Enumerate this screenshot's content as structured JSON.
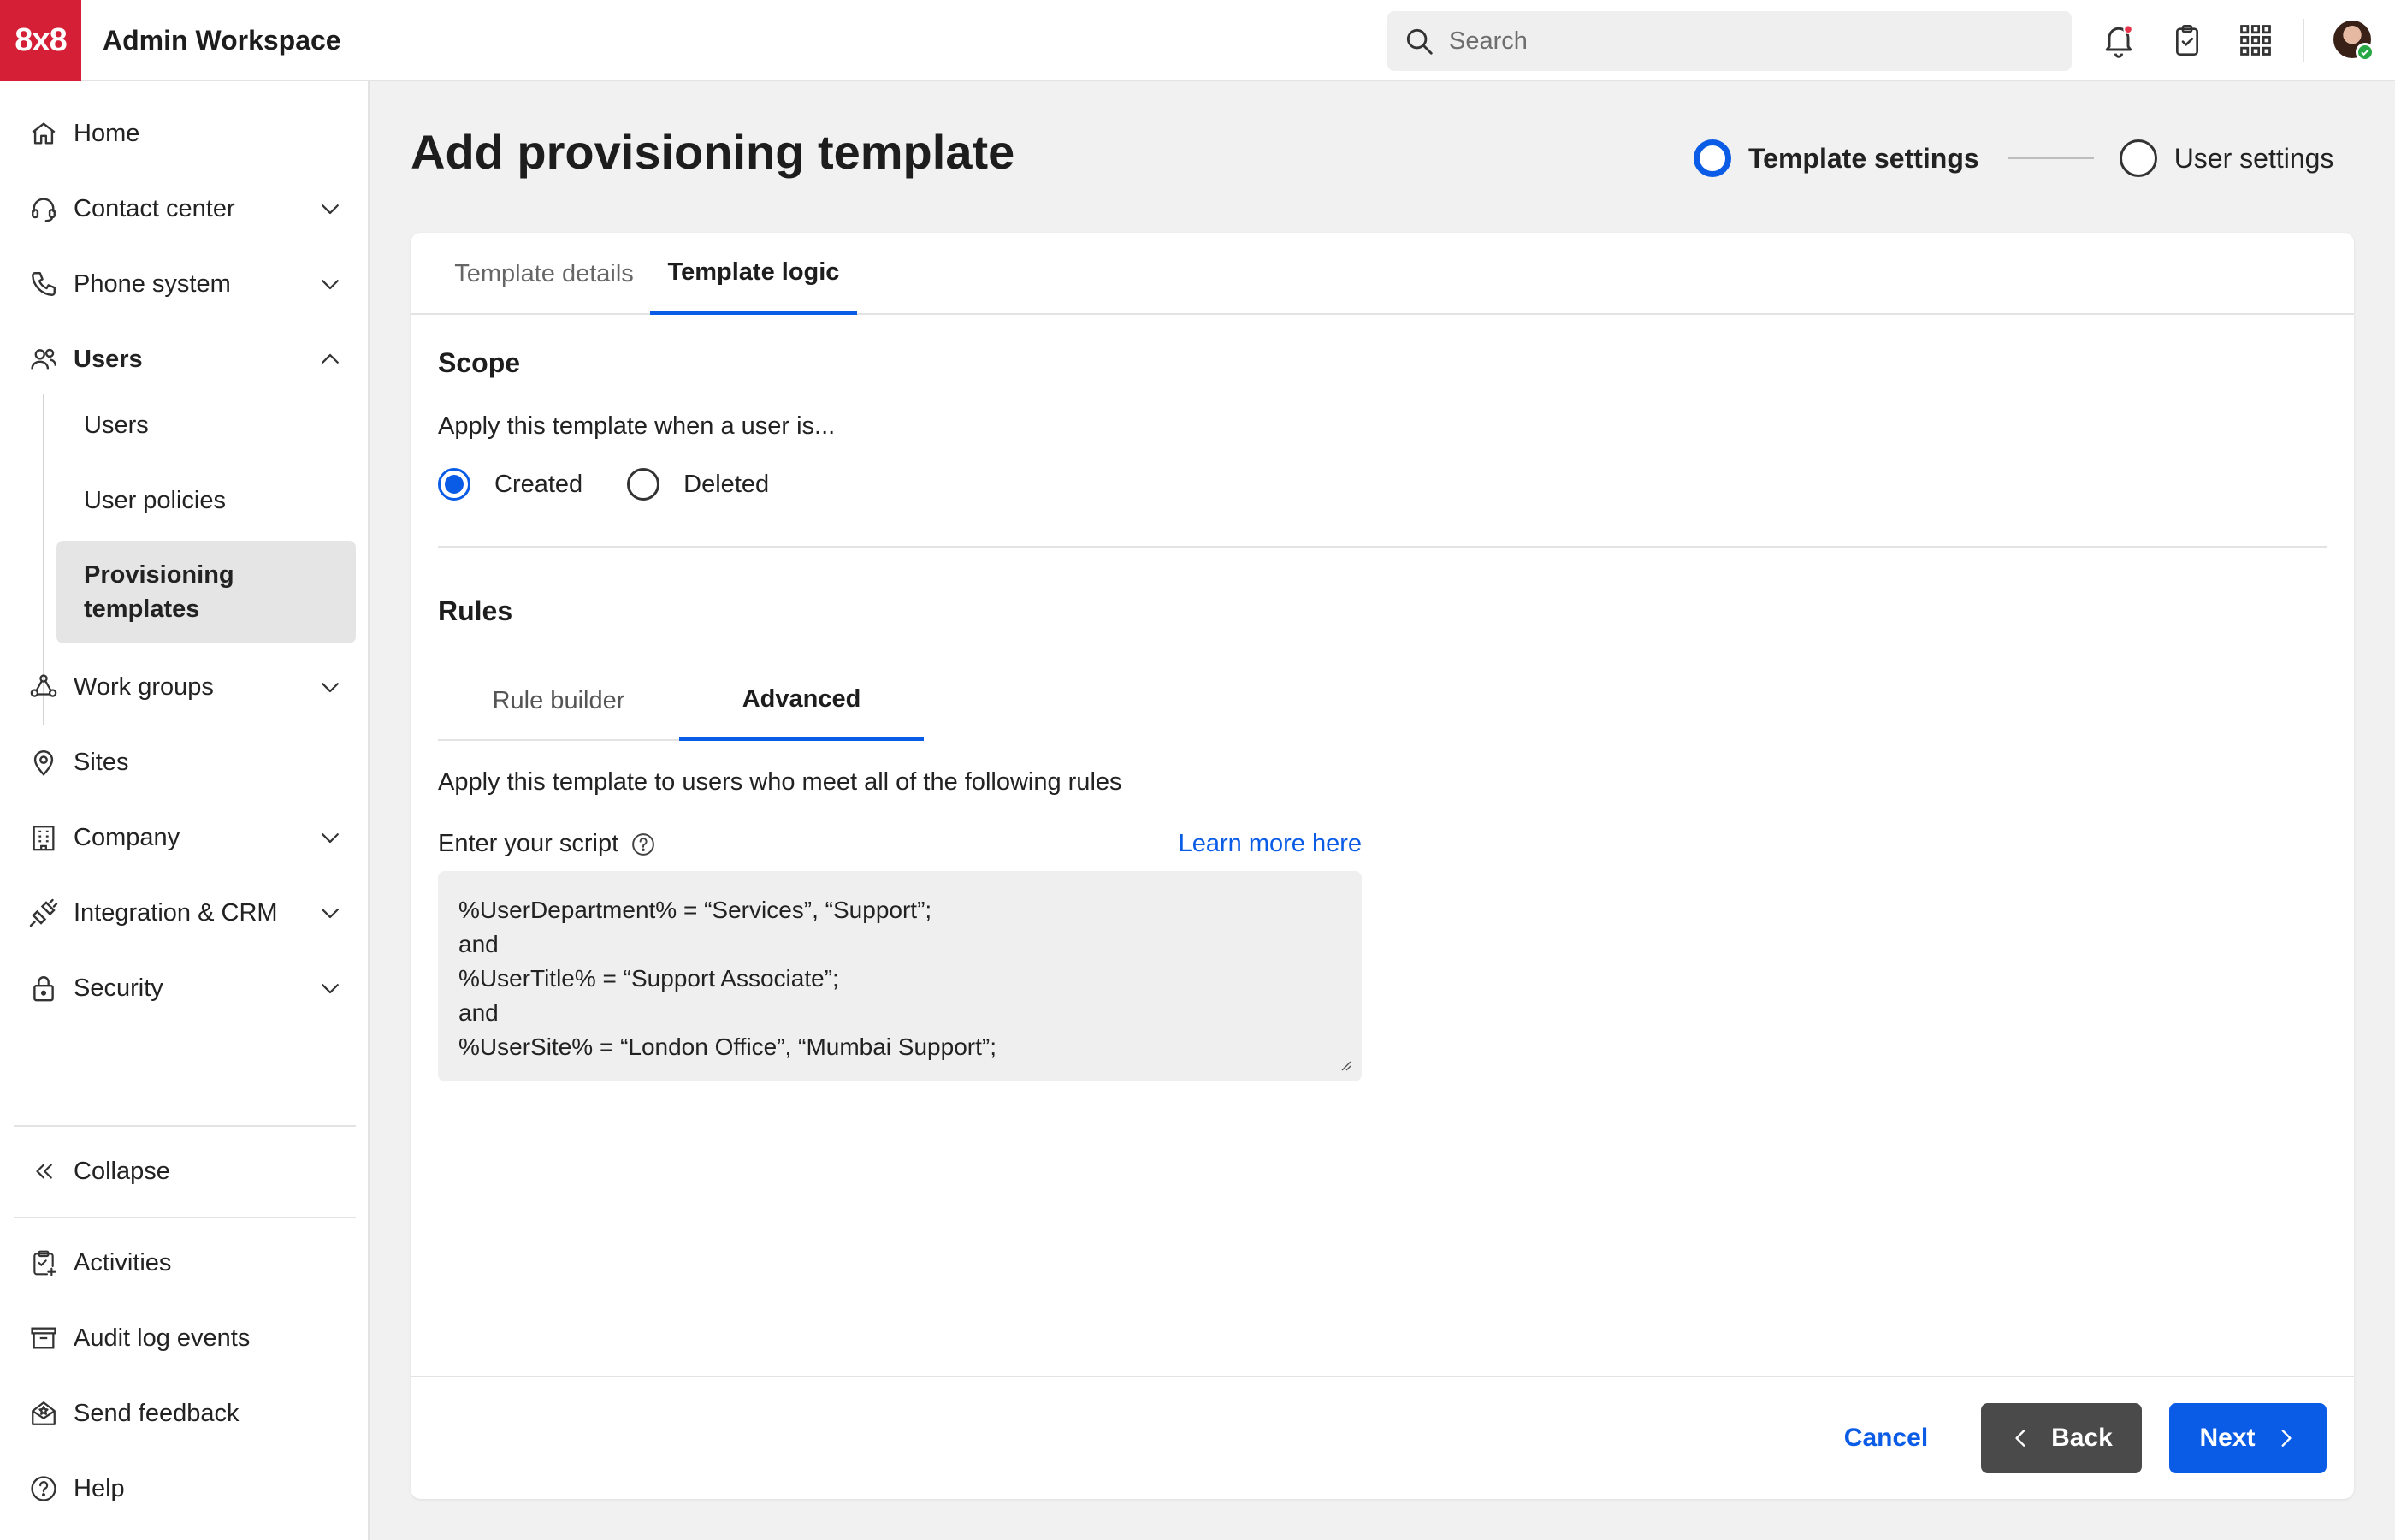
{
  "app": {
    "logo": "8x8",
    "title": "Admin Workspace",
    "brand_color": "#d51f36",
    "accent_color": "#0a5ce6"
  },
  "search": {
    "placeholder": "Search",
    "value": ""
  },
  "topbar_icons": [
    "bell-icon",
    "clipboard-check-icon",
    "apps-grid-icon"
  ],
  "sidebar": {
    "items": [
      {
        "label": "Home",
        "icon": "home-icon",
        "expandable": false
      },
      {
        "label": "Contact center",
        "icon": "headset-icon",
        "expandable": true,
        "expanded": false
      },
      {
        "label": "Phone system",
        "icon": "phone-icon",
        "expandable": true,
        "expanded": false
      },
      {
        "label": "Users",
        "icon": "users-icon",
        "expandable": true,
        "expanded": true
      },
      {
        "label": "Work groups",
        "icon": "work-groups-icon",
        "expandable": true,
        "expanded": false
      },
      {
        "label": "Sites",
        "icon": "location-pin-icon",
        "expandable": false
      },
      {
        "label": "Company",
        "icon": "building-icon",
        "expandable": true,
        "expanded": false
      },
      {
        "label": "Integration & CRM",
        "icon": "integration-icon",
        "expandable": true,
        "expanded": false
      },
      {
        "label": "Security",
        "icon": "lock-icon",
        "expandable": true,
        "expanded": false
      }
    ],
    "users_subitems": [
      {
        "label": "Users",
        "active": false
      },
      {
        "label": "User policies",
        "active": false
      },
      {
        "label": "Provisioning templates",
        "active": true
      }
    ],
    "collapse_label": "Collapse",
    "bottom_items": [
      {
        "label": "Activities",
        "icon": "clipboard-plus-icon"
      },
      {
        "label": "Audit log events",
        "icon": "archive-box-icon"
      },
      {
        "label": "Send feedback",
        "icon": "feedback-icon"
      },
      {
        "label": "Help",
        "icon": "help-circle-icon"
      }
    ]
  },
  "page": {
    "title": "Add provisioning template",
    "steps": [
      {
        "label": "Template settings",
        "active": true
      },
      {
        "label": "User settings",
        "active": false
      }
    ],
    "tabs": [
      {
        "label": "Template details",
        "active": false
      },
      {
        "label": "Template logic",
        "active": true
      }
    ],
    "scope": {
      "title": "Scope",
      "prompt": "Apply this template when a user is...",
      "options": [
        {
          "label": "Created",
          "checked": true
        },
        {
          "label": "Deleted",
          "checked": false
        }
      ]
    },
    "rules": {
      "title": "Rules",
      "tabs": [
        {
          "label": "Rule builder",
          "active": false
        },
        {
          "label": "Advanced",
          "active": true
        }
      ],
      "description": "Apply this template to users who meet all of the following rules",
      "script_label": "Enter your script",
      "learn_more": "Learn more here",
      "script": "%UserDepartment% = “Services”, “Support”;\nand\n%UserTitle% = “Support Associate”;\nand\n%UserSite% = “London Office”, “Mumbai Support”;"
    },
    "footer": {
      "cancel": "Cancel",
      "back": "Back",
      "next": "Next"
    }
  }
}
